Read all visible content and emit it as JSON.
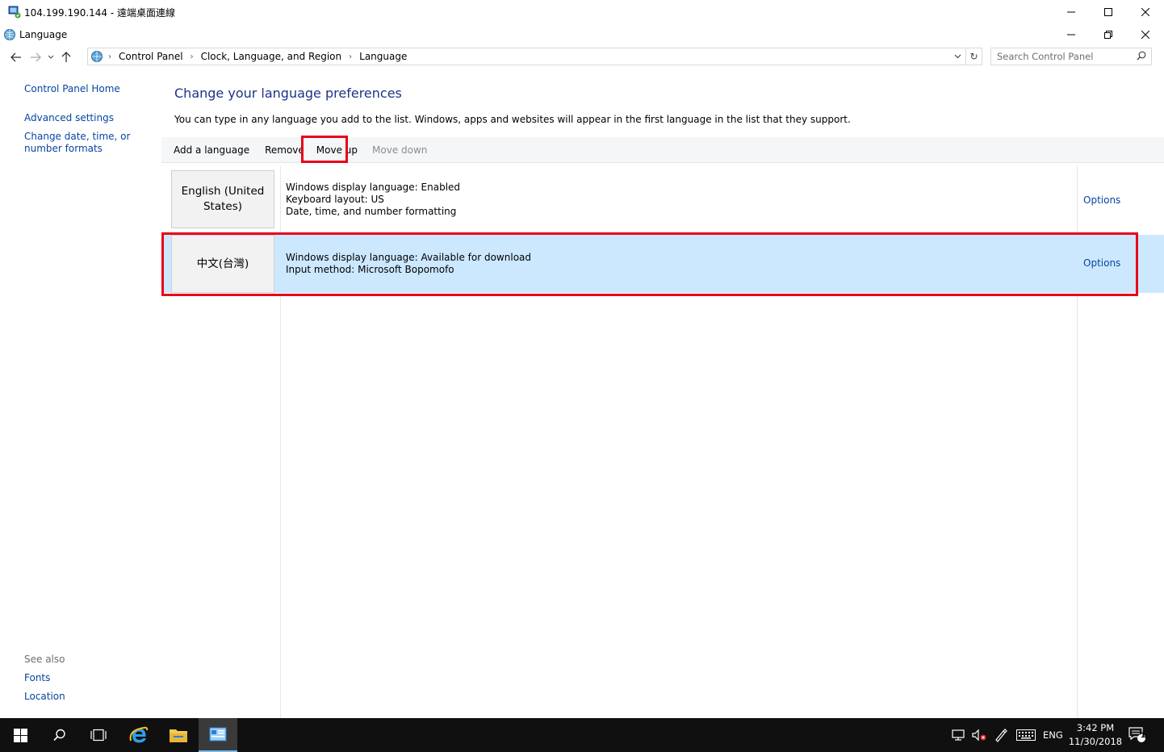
{
  "rdp": {
    "title": "104.199.190.144 - 遠端桌面連線",
    "icon": "remote-desktop-icon"
  },
  "window": {
    "title": "Language",
    "icon": "language-globe-icon"
  },
  "address": {
    "crumbs": [
      "Control Panel",
      "Clock, Language, and Region",
      "Language"
    ]
  },
  "search": {
    "placeholder": "Search Control Panel"
  },
  "left_pane": {
    "home": "Control Panel Home",
    "advanced": "Advanced settings",
    "change_date": "Change date, time, or number formats",
    "see_also": "See also",
    "fonts": "Fonts",
    "location": "Location"
  },
  "main": {
    "title": "Change your language preferences",
    "description": "You can type in any language you add to the list. Windows, apps and websites will appear in the first language in the list that they support."
  },
  "toolbar": {
    "add": "Add a language",
    "remove": "Remove",
    "move_up": "Move up",
    "move_down": "Move down"
  },
  "languages": [
    {
      "name": "English (United States)",
      "details": [
        "Windows display language: Enabled",
        "Keyboard layout: US",
        "Date, time, and number formatting"
      ],
      "options": "Options",
      "selected": false
    },
    {
      "name": "中文(台灣)",
      "details": [
        "Windows display language: Available for download",
        "Input method: Microsoft Bopomofo"
      ],
      "options": "Options",
      "selected": true
    }
  ],
  "taskbar": {
    "lang": "ENG",
    "time": "3:42 PM",
    "date": "11/30/2018",
    "notification_count": "1"
  },
  "colors": {
    "link": "#0645a0",
    "title": "#1e3287",
    "selected_row": "#cce8ff",
    "highlight": "#e8001c",
    "taskbar": "#101010"
  }
}
